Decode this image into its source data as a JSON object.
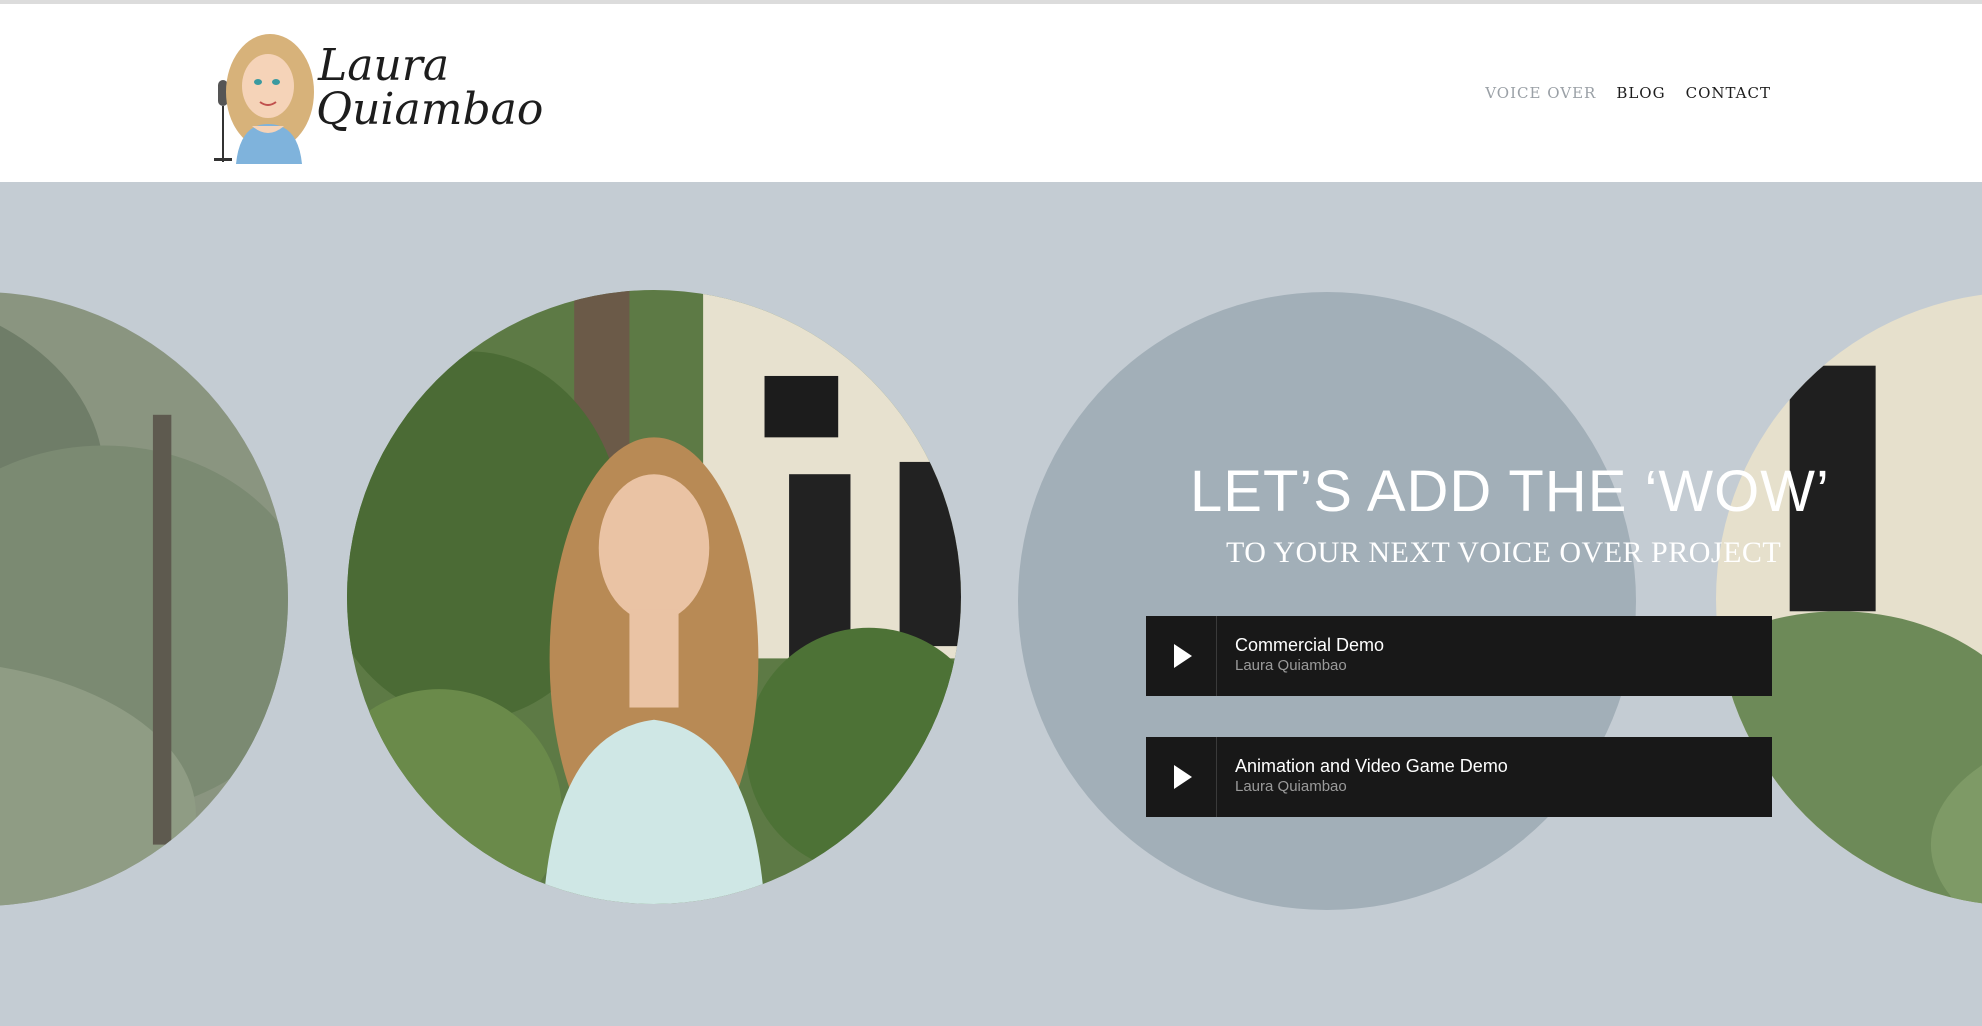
{
  "logo": {
    "line1": "Laura",
    "line2": "Quiambao",
    "icon": "voice-actor-cartoon-logo"
  },
  "nav": {
    "items": [
      {
        "label": "VOICE OVER",
        "active": true
      },
      {
        "label": "BLOG",
        "active": false
      },
      {
        "label": "CONTACT",
        "active": false
      }
    ]
  },
  "hero": {
    "headline": "LET’S ADD THE ‘WOW’",
    "subheadline": "TO YOUR NEXT VOICE OVER PROJECT",
    "players": [
      {
        "title": "Commercial Demo",
        "artist": "Laura Quiambao",
        "icon": "play-icon"
      },
      {
        "title": "Animation and Video Game Demo",
        "artist": "Laura Quiambao",
        "icon": "play-icon"
      }
    ]
  },
  "colors": {
    "hero_bg": "#c4ccd3",
    "blue_circle": "#a2afb8",
    "player_bg": "#181818",
    "nav_active": "#9aa0a6"
  }
}
